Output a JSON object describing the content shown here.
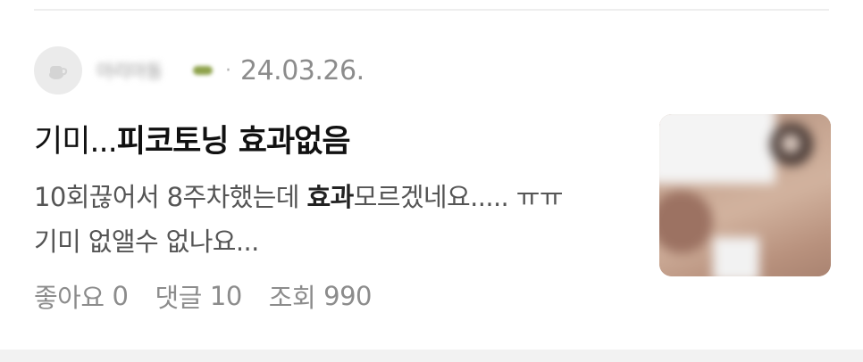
{
  "post": {
    "author_name": "아리아동",
    "date": "24.03.26.",
    "separator": "·",
    "title_prefix": "기미...",
    "title_highlight": "피코토닝 효과없음",
    "excerpt_before": "10회끊어서 8주차했는데 ",
    "excerpt_highlight": "효과",
    "excerpt_after": "모르겠네요..... ㅠㅠ",
    "excerpt_line2": "기미 없앨수 없나요...",
    "stats": {
      "likes_label": "좋아요",
      "likes_count": "0",
      "comments_label": "댓글",
      "comments_count": "10",
      "views_label": "조회",
      "views_count": "990"
    },
    "thumbnail_icon": "face-photo-blurred"
  },
  "colors": {
    "title": "#111111",
    "excerpt": "#555555",
    "meta": "#8c8c8c",
    "badge": "#8ea24b"
  }
}
